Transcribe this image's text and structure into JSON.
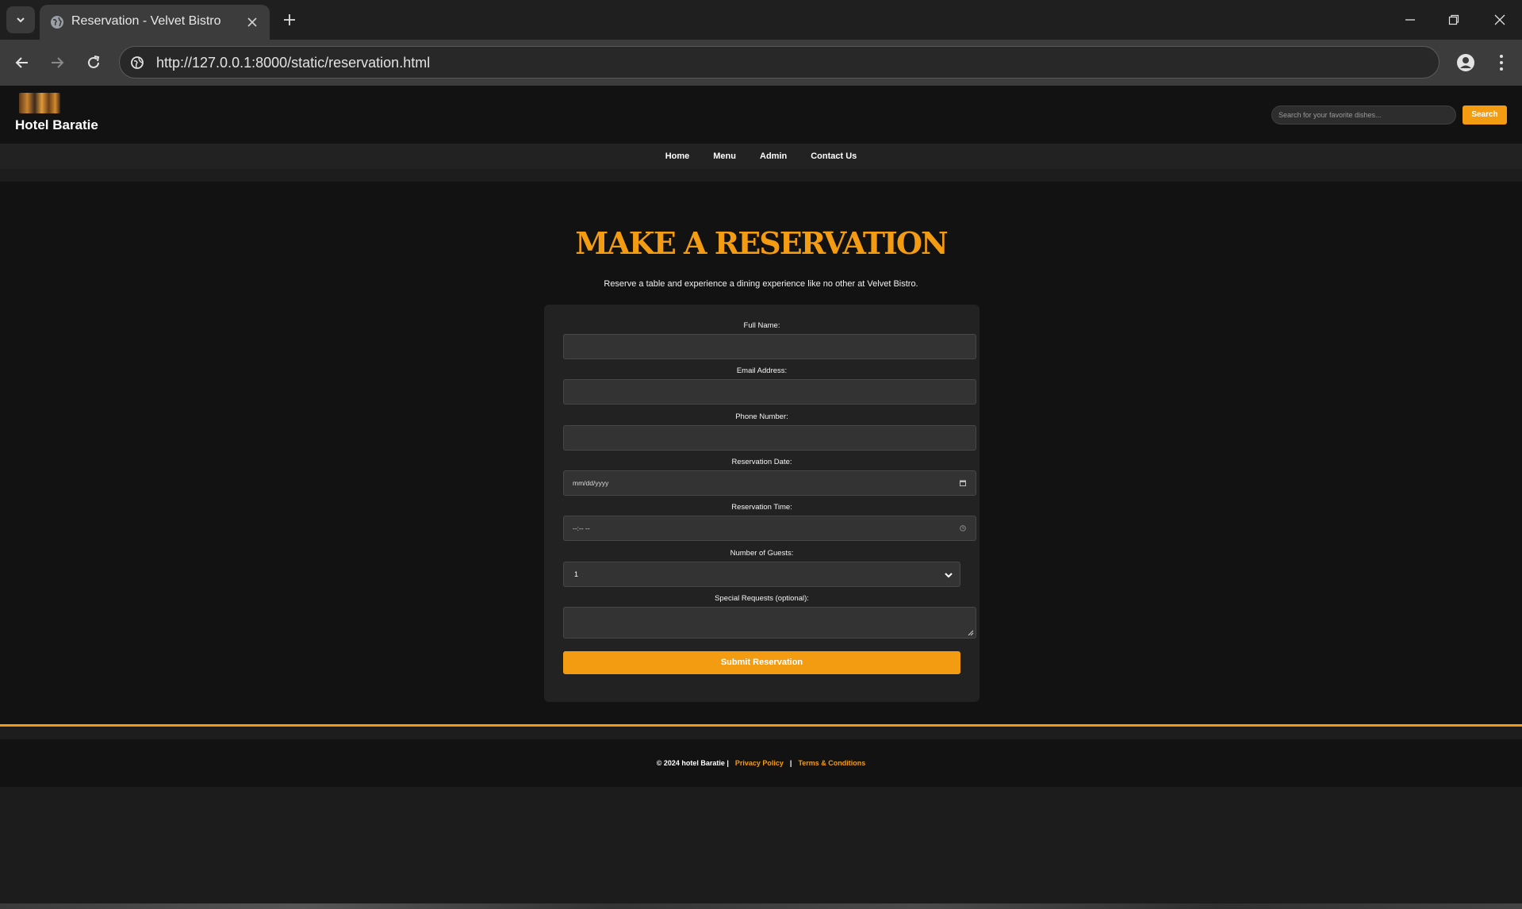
{
  "browser": {
    "tab_title": "Reservation - Velvet Bistro",
    "url": "http://127.0.0.1:8000/static/reservation.html"
  },
  "site": {
    "logo_text": "Hotel Baratie",
    "search_placeholder": "Search for your favorite dishes...",
    "search_button": "Search",
    "nav": [
      "Home",
      "Menu",
      "Admin",
      "Contact Us"
    ],
    "accent_color": "#f39c12"
  },
  "reservation": {
    "title": "MAKE A RESERVATION",
    "subtitle": "Reserve a table and experience a dining experience like no other at Velvet Bistro.",
    "fields": {
      "full_name_label": "Full Name:",
      "email_label": "Email Address:",
      "phone_label": "Phone Number:",
      "date_label": "Reservation Date:",
      "date_placeholder": "mm/dd/yyyy",
      "time_label": "Reservation Time:",
      "time_placeholder": "--:-- --",
      "guests_label": "Number of Guests:",
      "guests_value": "1",
      "requests_label": "Special Requests (optional):"
    },
    "submit_label": "Submit Reservation"
  },
  "footer": {
    "copyright": "© 2024 hotel Baratie |",
    "privacy": "Privacy Policy",
    "separator": "|",
    "terms": "Terms & Conditions"
  }
}
